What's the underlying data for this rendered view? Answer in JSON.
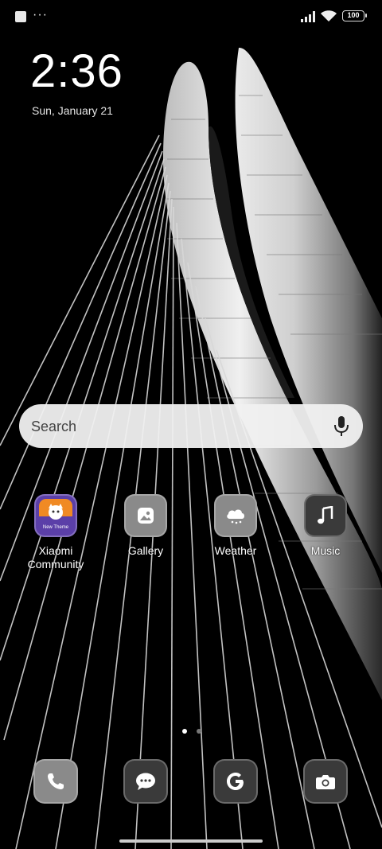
{
  "status_bar": {
    "battery": "100",
    "more": "···"
  },
  "lock": {
    "time": "2:36",
    "date": "Sun, January 21"
  },
  "search": {
    "placeholder": "Search"
  },
  "apps": [
    {
      "name": "Xiaomi Community",
      "label_line1": "Xiaomi",
      "label_line2": "Community",
      "icon": "xiaomi-community-icon",
      "badge": "New Theme"
    },
    {
      "name": "Gallery",
      "label": "Gallery",
      "icon": "gallery-icon"
    },
    {
      "name": "Weather",
      "label": "Weather",
      "icon": "weather-icon"
    },
    {
      "name": "Music",
      "label": "Music",
      "icon": "music-icon"
    }
  ],
  "dock": [
    {
      "name": "Phone",
      "icon": "phone-icon"
    },
    {
      "name": "Messages",
      "icon": "messages-icon"
    },
    {
      "name": "Google",
      "icon": "google-icon"
    },
    {
      "name": "Camera",
      "icon": "camera-icon"
    }
  ],
  "page_indicator": {
    "pages": 2,
    "current": 1
  },
  "colors": {
    "tile_gray": "#8a8a8a",
    "tile_dark": "#3a3a3a",
    "community_orange": "#f08a24",
    "community_purple": "#5b3fa8"
  }
}
